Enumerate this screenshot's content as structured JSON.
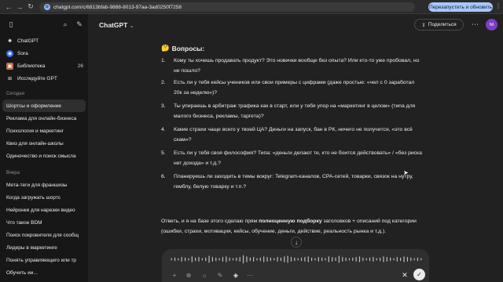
{
  "browser": {
    "url": "chatgpt.com/c/6813bfab-9888-8013-97aa-3ad0250f7258",
    "relaunch_label": "Перезапустить и обновить"
  },
  "sidebar": {
    "items": [
      {
        "label": "ChatGPT",
        "icon": "chatgpt-logo-icon"
      },
      {
        "label": "Sora",
        "icon": "sora-icon"
      },
      {
        "label": "Библиотека",
        "icon": "library-icon",
        "count": "26"
      },
      {
        "label": "Исследуйте GPT",
        "icon": "explore-gpt-icon"
      }
    ],
    "today_label": "Сегодня",
    "today_chats": [
      "Шортсы и оформление",
      "Реклама для онлайн-бизнеса",
      "Психология и маркетинг",
      "Квиз для онлайн-школы",
      "Одиночество и поиск смысла"
    ],
    "yesterday_label": "Вчера",
    "yesterday_chats": [
      "Мета-теги для франшизы",
      "Когда загружать шортс",
      "Нейронки для нарезки видео",
      "Что такое BDM",
      "Поиск покровителя для сообщ",
      "Лидеры в маркетинге",
      "Понять управляющего или тр",
      "Обучить ии..."
    ]
  },
  "header": {
    "model_label": "ChatGPT",
    "share_label": "Поделиться",
    "avatar_initials": "NI"
  },
  "content": {
    "heading_emoji": "🤔",
    "heading": "Вопросы:",
    "questions": [
      {
        "num": "1.",
        "text": "Кому ты хочешь продавать продукт? Это новички вообще без опыта? Или кто-то уже пробовал, но не пошло?"
      },
      {
        "num": "2.",
        "text": "Есть ли у тебя кейсы учеников или свои примеры с цифрами (даже простые: «чел с 0 заработал 20к за неделю»)?"
      },
      {
        "num": "3.",
        "text": "Ты упираешь в арбитраж трафика как в старт, или у тебя упор на «маркетинг в целом» (типа для малого бизнеса, рекламы, таргета)?"
      },
      {
        "num": "4.",
        "text": "Какие страхи чаще всего у твоей ЦА? Деньги на запуск, бан в РК, ничего не получится, «это всё скам»?"
      },
      {
        "num": "5.",
        "text": "Есть ли у тебя своя философия? Типа: «деньги делают те, кто не боится действовать» / «без риска нет дохода» и т.д.?"
      },
      {
        "num": "6.",
        "text": "Планируешь ли заходить в темы вокруг: Telegram-каналов, CPA-сетей, товарки, связок на нутру, гемблу, белую товарку и т.п.?"
      }
    ],
    "para_before": "Ответь, и я на базе этого сделаю прям ",
    "para_bold": "полноценную подборку",
    "para_after": " заголовков + описаний под категории (ошибки, страхи, мотивация, кейсы, обучение, деньги, действие, реальность рынка и т.д.)."
  },
  "composer": {
    "wave_levels": [
      2,
      3,
      2,
      4,
      3,
      2,
      5,
      3,
      4,
      2,
      3,
      6,
      4,
      3,
      2,
      4,
      5,
      3,
      2,
      3,
      4,
      7,
      5,
      3,
      4,
      2,
      3,
      5,
      4,
      3,
      2,
      4,
      3,
      5,
      6,
      4,
      3,
      2,
      3,
      4,
      5,
      3,
      2,
      4,
      3,
      2,
      5,
      4,
      3,
      6,
      4,
      3,
      2,
      3,
      4,
      5,
      3,
      2,
      3,
      4,
      2,
      3,
      5,
      4,
      3,
      2,
      4,
      3,
      5,
      4,
      3,
      2,
      3,
      2
    ]
  }
}
